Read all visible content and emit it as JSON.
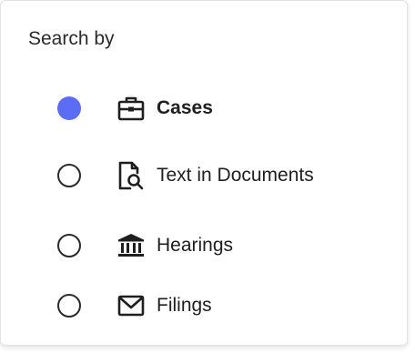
{
  "panel": {
    "title": "Search by"
  },
  "options": [
    {
      "label": "Cases",
      "icon": "briefcase-icon",
      "selected": true
    },
    {
      "label": "Text in Documents",
      "icon": "document-search-icon",
      "selected": false
    },
    {
      "label": "Hearings",
      "icon": "courthouse-icon",
      "selected": false
    },
    {
      "label": "Filings",
      "icon": "envelope-icon",
      "selected": false
    }
  ],
  "colors": {
    "accent": "#5b6cf6",
    "text": "#1f1f1f",
    "border": "#e2e2e2"
  }
}
